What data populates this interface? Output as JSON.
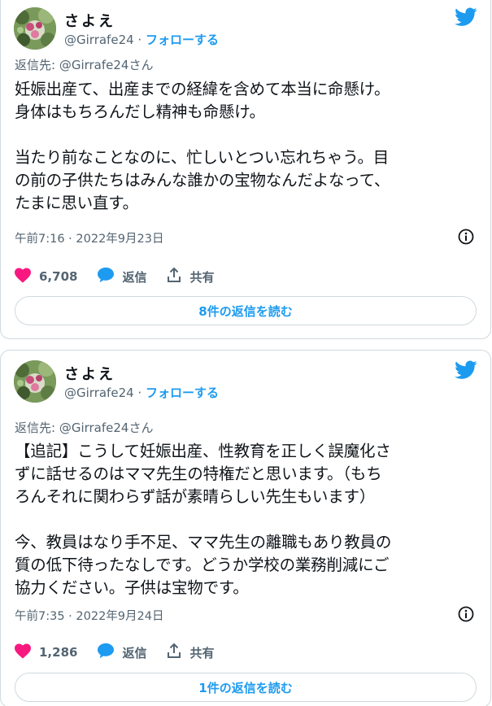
{
  "tweets": [
    {
      "author": {
        "name": "さよえ",
        "handle": "@Girrafe24",
        "separator": " · ",
        "follow_label": "フォローする"
      },
      "reply_to": "返信先: @Girrafe24さん",
      "text_lines": [
        "妊娠出産て、出産までの経緯を含めて本当に命懸け。",
        "身体はもちろんだし精神も命懸け。",
        "",
        "当たり前なことなのに、忙しいとつい忘れちゃう。目",
        "の前の子供たちはみんな誰かの宝物なんだよなって、",
        "たまに思い直す。"
      ],
      "timestamp": "午前7:16 · 2022年9月23日",
      "likes": "6,708",
      "reply_label": "返信",
      "share_label": "共有",
      "read_replies_label": "8件の返信を読む"
    },
    {
      "author": {
        "name": "さよえ",
        "handle": "@Girrafe24",
        "separator": " · ",
        "follow_label": "フォローする"
      },
      "reply_to": "返信先: @Girrafe24さん",
      "text_lines": [
        "【追記】こうして妊娠出産、性教育を正しく誤魔化さ",
        "ずに話せるのはママ先生の特権だと思います。（もち",
        "ろんそれに関わらず話が素晴らしい先生もいます）",
        "",
        "今、教員はなり手不足、ママ先生の離職もあり教員の",
        "質の低下待ったなしです。どうか学校の業務削減にご",
        "協力ください。子供は宝物です。"
      ],
      "timestamp": "午前7:35 · 2022年9月24日",
      "likes": "1,286",
      "reply_label": "返信",
      "share_label": "共有",
      "read_replies_label": "1件の返信を読む"
    }
  ],
  "colors": {
    "accent": "#1d9bf0",
    "like": "#f91880",
    "secondary_text": "#536471",
    "border": "#cfd9de"
  },
  "icons": {
    "brand": "twitter-bird-icon",
    "like": "heart-icon",
    "reply": "speech-bubble-icon",
    "share": "share-arrow-icon",
    "info": "info-icon"
  }
}
